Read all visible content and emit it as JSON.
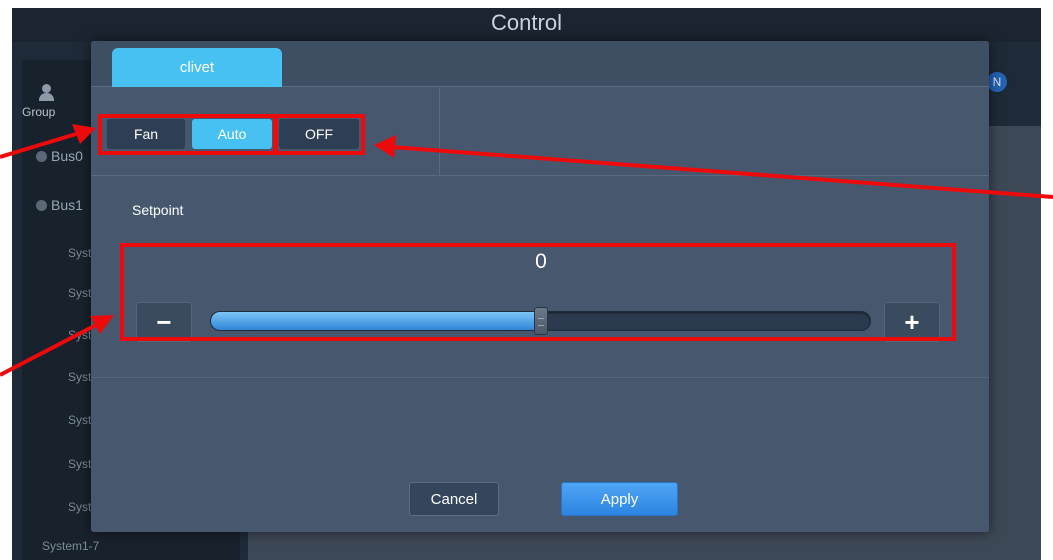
{
  "app": {
    "title": "Control",
    "sidebar": {
      "group_label": "Group",
      "bus_rows": [
        "Bus0",
        "Bus1"
      ],
      "system_items": [
        "Syste",
        "Syste",
        "Syste",
        "Syste",
        "Syste",
        "Syste",
        "Syste",
        "System1-7"
      ]
    },
    "status_badge": "N"
  },
  "dialog": {
    "tab_label": "clivet",
    "modes": {
      "fan": "Fan",
      "auto": "Auto",
      "off": "OFF",
      "selected": "Auto"
    },
    "setpoint": {
      "label": "Setpoint",
      "value": "0",
      "minus_label": "−",
      "plus_label": "+",
      "slider_fraction": 0.5
    },
    "buttons": {
      "cancel": "Cancel",
      "apply": "Apply"
    }
  },
  "colors": {
    "accent": "#47c0f2",
    "apply_button": "#3a95ea",
    "annotation": "#ec0a0a"
  },
  "icons": {
    "group": "group-icon",
    "bus_collapse": "collapse-dot-icon"
  }
}
